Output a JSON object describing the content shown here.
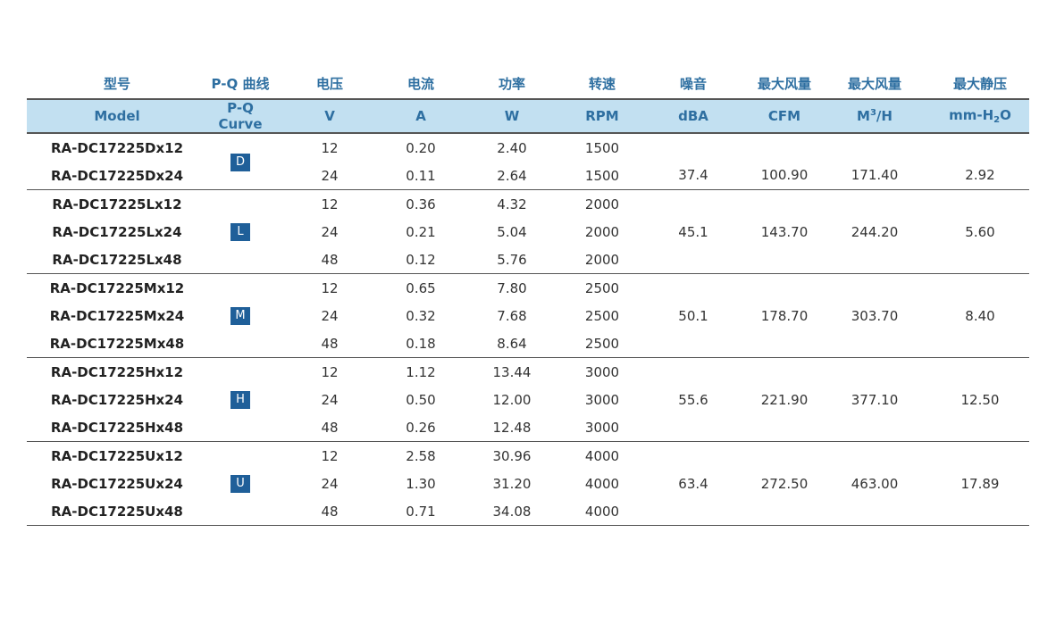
{
  "header_cn": [
    "型号",
    "P-Q 曲线",
    "电压",
    "电流",
    "功率",
    "转速",
    "噪音",
    "最大风量",
    "最大风量",
    "最大静压"
  ],
  "header_en": {
    "model": "Model",
    "curve": "P-Q Curve",
    "voltage": "V",
    "current": "A",
    "power": "W",
    "speed": "RPM",
    "noise": "dBA",
    "airflow_cfm": "CFM",
    "airflow_m3h_prefix": "M",
    "airflow_m3h_sup": "3",
    "airflow_m3h_suffix": "/H",
    "pressure_prefix": "mm-H",
    "pressure_sub": "2",
    "pressure_suffix": "O"
  },
  "groups": [
    {
      "curve": "D",
      "noise": "37.4",
      "cfm": "100.90",
      "m3h": "171.40",
      "pressure": "2.92",
      "rows": [
        {
          "model": "RA-DC17225Dx12",
          "v": "12",
          "a": "0.20",
          "w": "2.40",
          "rpm": "1500"
        },
        {
          "model": "RA-DC17225Dx24",
          "v": "24",
          "a": "0.11",
          "w": "2.64",
          "rpm": "1500"
        }
      ]
    },
    {
      "curve": "L",
      "noise": "45.1",
      "cfm": "143.70",
      "m3h": "244.20",
      "pressure": "5.60",
      "rows": [
        {
          "model": "RA-DC17225Lx12",
          "v": "12",
          "a": "0.36",
          "w": "4.32",
          "rpm": "2000"
        },
        {
          "model": "RA-DC17225Lx24",
          "v": "24",
          "a": "0.21",
          "w": "5.04",
          "rpm": "2000"
        },
        {
          "model": "RA-DC17225Lx48",
          "v": "48",
          "a": "0.12",
          "w": "5.76",
          "rpm": "2000"
        }
      ]
    },
    {
      "curve": "M",
      "noise": "50.1",
      "cfm": "178.70",
      "m3h": "303.70",
      "pressure": "8.40",
      "rows": [
        {
          "model": "RA-DC17225Mx12",
          "v": "12",
          "a": "0.65",
          "w": "7.80",
          "rpm": "2500"
        },
        {
          "model": "RA-DC17225Mx24",
          "v": "24",
          "a": "0.32",
          "w": "7.68",
          "rpm": "2500"
        },
        {
          "model": "RA-DC17225Mx48",
          "v": "48",
          "a": "0.18",
          "w": "8.64",
          "rpm": "2500"
        }
      ]
    },
    {
      "curve": "H",
      "noise": "55.6",
      "cfm": "221.90",
      "m3h": "377.10",
      "pressure": "12.50",
      "rows": [
        {
          "model": "RA-DC17225Hx12",
          "v": "12",
          "a": "1.12",
          "w": "13.44",
          "rpm": "3000"
        },
        {
          "model": "RA-DC17225Hx24",
          "v": "24",
          "a": "0.50",
          "w": "12.00",
          "rpm": "3000"
        },
        {
          "model": "RA-DC17225Hx48",
          "v": "48",
          "a": "0.26",
          "w": "12.48",
          "rpm": "3000"
        }
      ]
    },
    {
      "curve": "U",
      "noise": "63.4",
      "cfm": "272.50",
      "m3h": "463.00",
      "pressure": "17.89",
      "rows": [
        {
          "model": "RA-DC17225Ux12",
          "v": "12",
          "a": "2.58",
          "w": "30.96",
          "rpm": "4000"
        },
        {
          "model": "RA-DC17225Ux24",
          "v": "24",
          "a": "1.30",
          "w": "31.20",
          "rpm": "4000"
        },
        {
          "model": "RA-DC17225Ux48",
          "v": "48",
          "a": "0.71",
          "w": "34.08",
          "rpm": "4000"
        }
      ]
    }
  ]
}
